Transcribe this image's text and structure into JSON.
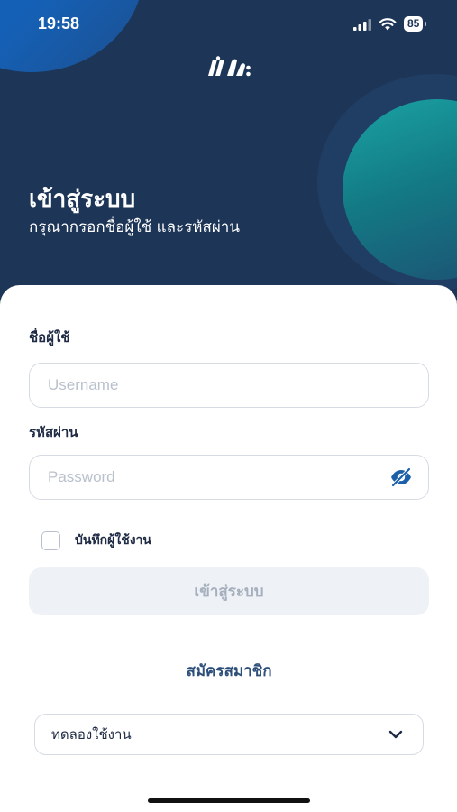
{
  "status_bar": {
    "time": "19:58",
    "battery": "85"
  },
  "header": {
    "title": "เข้าสู่ระบบ",
    "subtitle": "กรุณากรอกชื่อผู้ใช้ และรหัสผ่าน"
  },
  "form": {
    "username_label": "ชื่อผู้ใช้",
    "username_placeholder": "Username",
    "username_value": "",
    "password_label": "รหัสผ่าน",
    "password_placeholder": "Password",
    "password_value": "",
    "remember_label": "บันทึกผู้ใช้งาน",
    "remember_checked": false,
    "login_button": "เข้าสู่ระบบ"
  },
  "signup": {
    "label": "สมัครสมาชิก"
  },
  "select": {
    "value": "ทดลองใช้งาน"
  },
  "icons": {
    "logo": "brand-logo",
    "password_toggle": "eye-off-icon",
    "dropdown": "chevron-down-icon"
  },
  "colors": {
    "header_bg": "#1d3556",
    "accent_blue": "#1b5fa8",
    "signup_text": "#2e4f7a"
  }
}
